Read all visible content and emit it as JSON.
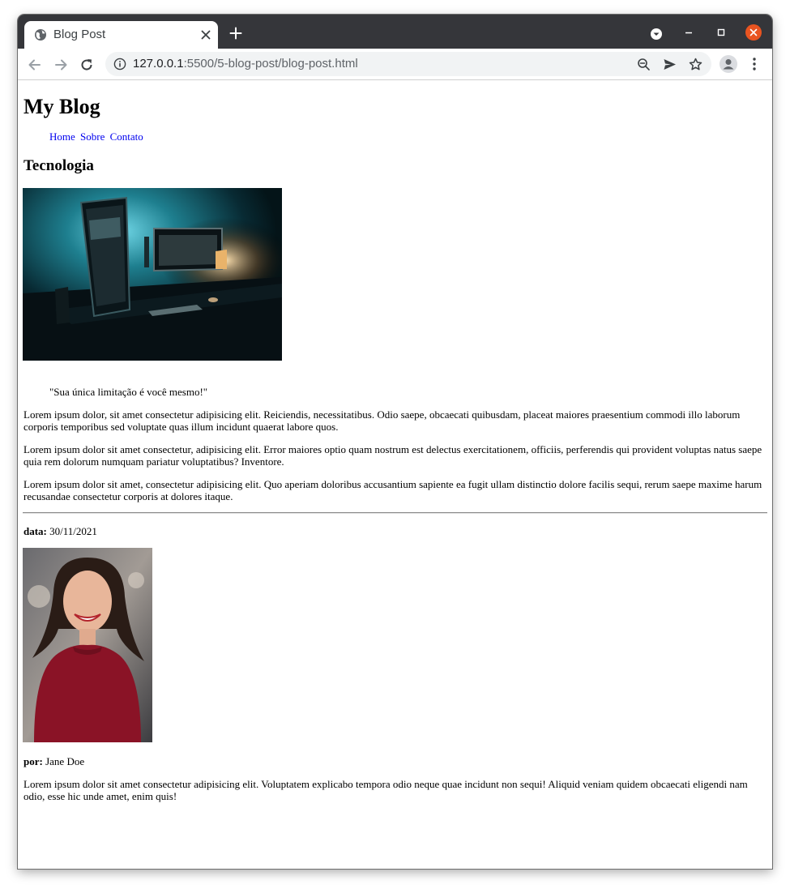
{
  "browser": {
    "tab_title": "Blog Post",
    "url_host": "127.0.0.1",
    "url_rest": ":5500/5-blog-post/blog-post.html"
  },
  "page": {
    "site_title": "My Blog",
    "nav": [
      "Home",
      "Sobre",
      "Contato"
    ],
    "category": "Tecnologia",
    "quote": "\"Sua única limitação é você mesmo!\"",
    "paragraphs": [
      "Lorem ipsum dolor, sit amet consectetur adipisicing elit. Reiciendis, necessitatibus. Odio saepe, obcaecati quibusdam, placeat maiores praesentium commodi illo laborum corporis temporibus sed voluptate quas illum incidunt quaerat labore quos.",
      "Lorem ipsum dolor sit amet consectetur, adipisicing elit. Error maiores optio quam nostrum est delectus exercitationem, officiis, perferendis qui provident voluptas natus saepe quia rem dolorum numquam pariatur voluptatibus? Inventore.",
      "Lorem ipsum dolor sit amet, consectetur adipisicing elit. Quo aperiam doloribus accusantium sapiente ea fugit ullam distinctio dolore facilis sequi, rerum saepe maxime harum recusandae consectetur corporis at dolores itaque."
    ],
    "date_label": "data:",
    "date_value": "30/11/2021",
    "author_label": "por:",
    "author_value": "Jane Doe",
    "bio": "Lorem ipsum dolor sit amet consectetur adipisicing elit. Voluptatem explicabo tempora odio neque quae incidunt non sequi! Aliquid veniam quidem obcaecati eligendi nam odio, esse hic unde amet, enim quis!"
  },
  "colors": {
    "tabstrip": "#35363a",
    "link": "#0000ee",
    "close_button": "#e95420"
  }
}
